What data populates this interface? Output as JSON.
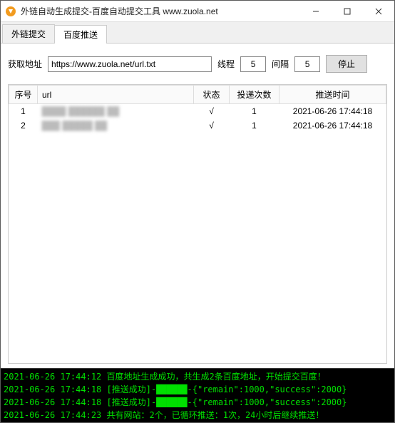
{
  "window": {
    "title": "外链自动生成提交-百度自动提交工具 www.zuola.net"
  },
  "tabs": [
    {
      "label": "外链提交",
      "active": false
    },
    {
      "label": "百度推送",
      "active": true
    }
  ],
  "controls": {
    "fetch_label": "获取地址",
    "fetch_value": "https://www.zuola.net/url.txt",
    "threads_label": "线程",
    "threads_value": "5",
    "interval_label": "间隔",
    "interval_value": "5",
    "stop_label": "停止"
  },
  "table": {
    "headers": [
      "序号",
      "url",
      "状态",
      "投递次数",
      "推送时间"
    ],
    "rows": [
      {
        "index": "1",
        "url": "████ ██████ ██",
        "status": "√",
        "count": "1",
        "time": "2021-06-26 17:44:18"
      },
      {
        "index": "2",
        "url": "███ █████ ██",
        "status": "√",
        "count": "1",
        "time": "2021-06-26 17:44:18"
      }
    ]
  },
  "console": [
    {
      "ts": "2021-06-26 17:44:12",
      "msg": "百度地址生成成功，共生成2条百度地址，开始提交百度！"
    },
    {
      "ts": "2021-06-26 17:44:18",
      "msg": "[推送成功]-██████-{\"remain\":1000,\"success\":2000}"
    },
    {
      "ts": "2021-06-26 17:44:18",
      "msg": "[推送成功]-██████-{\"remain\":1000,\"success\":2000}"
    },
    {
      "ts": "2021-06-26 17:44:23",
      "msg": "共有网站：2个，已循环推送：1次，24小时后继续推送！"
    }
  ]
}
